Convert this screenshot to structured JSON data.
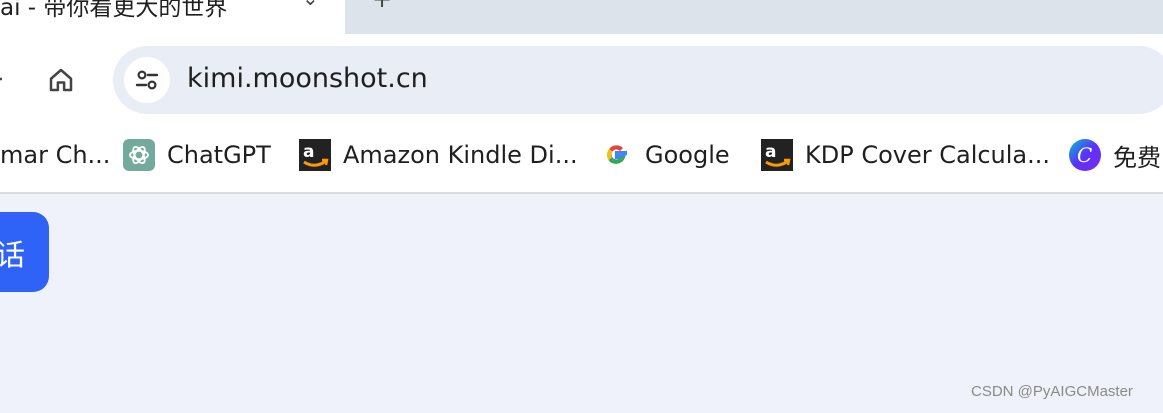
{
  "tab": {
    "title": "ai - 带你看更大的世界",
    "close_icon": "close-icon",
    "new_tab_icon": "plus-icon"
  },
  "toolbar": {
    "home_icon": "home-icon",
    "site_info_icon": "tune-icon",
    "url": "kimi.moonshot.cn"
  },
  "bookmarks": [
    {
      "label": "mar Ch...",
      "icon": "none"
    },
    {
      "label": "ChatGPT",
      "icon": "openai-icon"
    },
    {
      "label": "Amazon Kindle Di...",
      "icon": "amazon-icon"
    },
    {
      "label": "Google",
      "icon": "google-icon"
    },
    {
      "label": "KDP Cover Calcula...",
      "icon": "amazon-icon"
    },
    {
      "label": "免费",
      "icon": "canva-icon"
    }
  ],
  "page": {
    "new_chat_label": "话",
    "watermark": "CSDN @PyAIGCMaster"
  },
  "colors": {
    "accent": "#2f62f6",
    "tabstrip": "#dde3ea",
    "omnibox": "#e9edf6",
    "page_bg": "#eff2fa"
  }
}
